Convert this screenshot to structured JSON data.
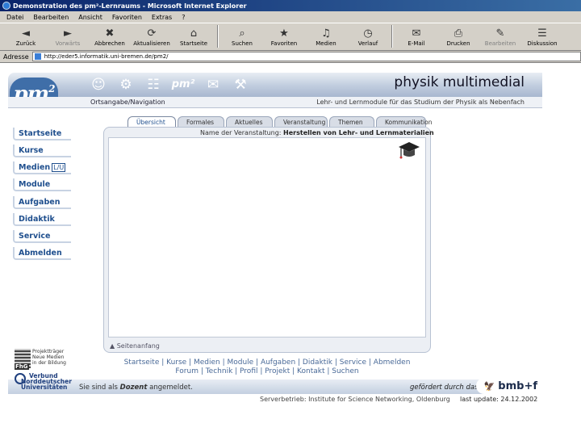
{
  "window": {
    "title": "Demonstration des pm²-Lernraums - Microsoft Internet Explorer"
  },
  "menubar": [
    "Datei",
    "Bearbeiten",
    "Ansicht",
    "Favoriten",
    "Extras",
    "?"
  ],
  "toolbar": [
    {
      "label": "Zurück",
      "icon": "◄",
      "dim": false
    },
    {
      "label": "Vorwärts",
      "icon": "►",
      "dim": true
    },
    {
      "label": "Abbrechen",
      "icon": "✖",
      "dim": false
    },
    {
      "label": "Aktualisieren",
      "icon": "⟳",
      "dim": false
    },
    {
      "label": "Startseite",
      "icon": "⌂",
      "dim": false
    },
    {
      "label": "Suchen",
      "icon": "⌕",
      "dim": false
    },
    {
      "label": "Favoriten",
      "icon": "★",
      "dim": false
    },
    {
      "label": "Medien",
      "icon": "♫",
      "dim": false
    },
    {
      "label": "Verlauf",
      "icon": "◷",
      "dim": false
    },
    {
      "label": "E-Mail",
      "icon": "✉",
      "dim": false
    },
    {
      "label": "Drucken",
      "icon": "⎙",
      "dim": false
    },
    {
      "label": "Bearbeiten",
      "icon": "✎",
      "dim": true
    },
    {
      "label": "Diskussion",
      "icon": "☰",
      "dim": false
    }
  ],
  "address": {
    "label": "Adresse",
    "url": "http://eder5.informatik.uni-bremen.de/pm2/"
  },
  "header": {
    "brand": "physik multimedial",
    "nav_label": "Ortsangabe/Navigation",
    "subtitle": "Lehr- und Lernmodule für das Studium der Physik als Nebenfach"
  },
  "sidebar": [
    {
      "label": "Startseite"
    },
    {
      "label": "Kurse"
    },
    {
      "label": "Medien",
      "tag": "L/U"
    },
    {
      "label": "Module"
    },
    {
      "label": "Aufgaben"
    },
    {
      "label": "Didaktik"
    },
    {
      "label": "Service"
    },
    {
      "label": "Abmelden"
    }
  ],
  "tabs": [
    "Übersicht",
    "Formales",
    "Aktuelles",
    "Veranstaltung",
    "Themen",
    "Kommunikation"
  ],
  "active_tab": "Übersicht",
  "event": {
    "prefix": "Name der Veranstaltung:",
    "name": "Herstellen von Lehr- und Lernmaterialien"
  },
  "back_to_top": "▲ Seitenanfang",
  "footer_links_row1": "Startseite | Kurse | Medien | Module | Aufgaben | Didaktik | Service | Abmelden",
  "footer_links_row2": "Forum | Technik | Profil | Projekt | Kontakt | Suchen",
  "login_note": {
    "before": "Sie sind als",
    "role": "Dozent",
    "after": "angemeldet."
  },
  "sponsor_text": "gefördert durch das",
  "bmbf": "bmb+f",
  "server_info": "Serverbetrieb: Institute for Science Networking, Oldenburg",
  "last_update": "last update: 24.12.2002",
  "fhg": {
    "lines": [
      "Projektträger",
      "Neue Medien",
      "in der Bildung"
    ],
    "short": "FhG"
  },
  "verbund": {
    "lines": [
      "Verbund",
      "Norddeutscher",
      "Universitäten"
    ]
  }
}
